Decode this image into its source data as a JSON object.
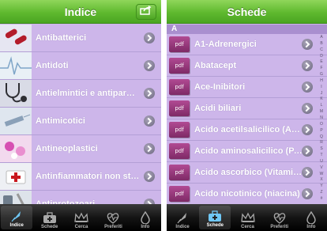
{
  "left": {
    "title": "Indice",
    "items": [
      {
        "label": "Antibatterici",
        "thumb": "capsules-icon",
        "thumb_color": "#e6e6f2",
        "accent": "#b31c2a"
      },
      {
        "label": "Antidoti",
        "thumb": "ecg-wave-icon",
        "thumb_color": "#e9f0f6",
        "accent": "#7fa6c8"
      },
      {
        "label": "Antielmintici e antiparassitari",
        "thumb": "stethoscope-icon",
        "thumb_color": "#d9dbe6",
        "accent": "#2e2e33"
      },
      {
        "label": "Antimicotici",
        "thumb": "syringe-icon",
        "thumb_color": "#dfe6ef",
        "accent": "#8aa0b8"
      },
      {
        "label": "Antineoplastici",
        "thumb": "pills-icon",
        "thumb_color": "#f2d9ee",
        "accent": "#d64fb2"
      },
      {
        "label": "Antinfiammatori non steroidei",
        "thumb": "first-aid-icon",
        "thumb_color": "#eef0f4",
        "accent": "#c8181e"
      },
      {
        "label": "Antiprotozoari",
        "thumb": "medical-tools-icon",
        "thumb_color": "#dde3ea",
        "accent": "#6f7d8c"
      }
    ],
    "tabs": [
      {
        "label": "Indice",
        "icon": "quill-icon",
        "active": true
      },
      {
        "label": "Schede",
        "icon": "medical-bag-icon",
        "active": false
      },
      {
        "label": "Cerca",
        "icon": "crown-icon",
        "active": false
      },
      {
        "label": "Preferiti",
        "icon": "heartbeat-icon",
        "active": false
      },
      {
        "label": "Info",
        "icon": "drop-icon",
        "active": false
      }
    ]
  },
  "right": {
    "title": "Schede",
    "section": "A",
    "pdf_badge": "pdf",
    "items": [
      "A1-Adrenergici",
      "Abatacept",
      "Ace-Inibitori",
      "Acidi biliari",
      "Acido acetilsalicilico (Aspirina)",
      "Acido aminosalicilico (PAS)",
      "Acido ascorbico (Vitamina C)",
      "Acido nicotinico (niacina)"
    ],
    "index_letters": [
      "A",
      "B",
      "C",
      "D",
      "E",
      "F",
      "G",
      "H",
      "I",
      "J",
      "K",
      "L",
      "M",
      "N",
      "O",
      "P",
      "Q",
      "R",
      "S",
      "T",
      "U",
      "V",
      "W",
      "X",
      "Y",
      "Z",
      "#"
    ],
    "tabs": [
      {
        "label": "Indice",
        "icon": "quill-icon",
        "active": false
      },
      {
        "label": "Schede",
        "icon": "medical-bag-icon",
        "active": true
      },
      {
        "label": "Cerca",
        "icon": "crown-icon",
        "active": false
      },
      {
        "label": "Preferiti",
        "icon": "heartbeat-icon",
        "active": false
      },
      {
        "label": "Info",
        "icon": "drop-icon",
        "active": false
      }
    ]
  },
  "colors": {
    "navbar": "#5fb92f",
    "list_bg": "#cdb6ea",
    "section_bg": "#a98fcf",
    "pdf_badge": "#9a3a7e"
  }
}
